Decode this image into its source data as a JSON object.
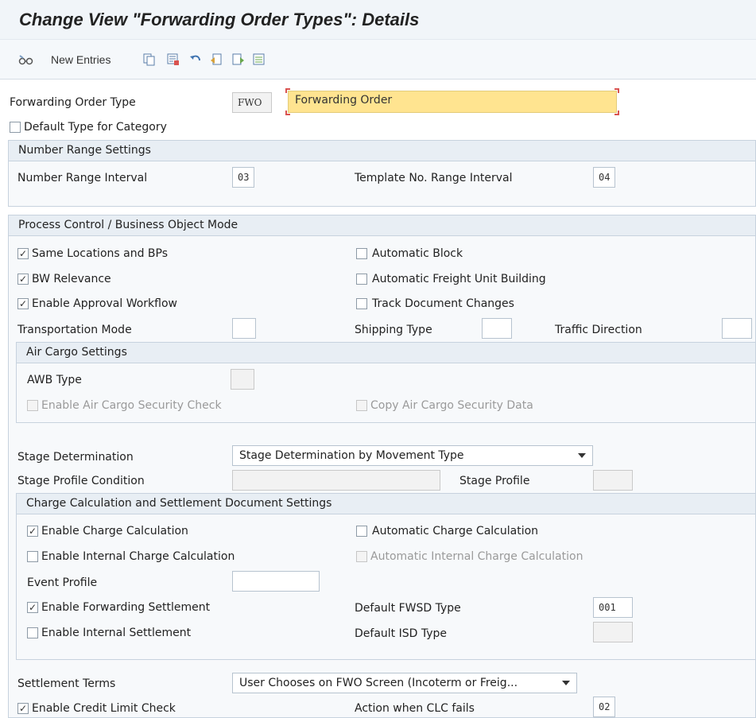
{
  "title": "Change View \"Forwarding Order Types\": Details",
  "toolbar": {
    "new_entries_label": "New Entries",
    "icons": [
      "edit-glasses-icon",
      "copy-icon",
      "delete-icon",
      "undo-icon",
      "previous-entry-icon",
      "next-entry-icon",
      "select-all-icon"
    ]
  },
  "header": {
    "fwd_order_type_label": "Forwarding Order Type",
    "fwd_order_type_code": "FWO",
    "fwd_order_type_desc": "Forwarding Order",
    "default_type_label": "Default Type for Category",
    "default_type_checked": false
  },
  "number_range": {
    "title": "Number Range Settings",
    "interval_label": "Number Range Interval",
    "interval_value": "03",
    "template_label": "Template No. Range Interval",
    "template_value": "04"
  },
  "process_control": {
    "title": "Process Control / Business Object Mode",
    "same_locations_label": "Same Locations and BPs",
    "same_locations_checked": true,
    "bw_relevance_label": "BW Relevance",
    "bw_relevance_checked": true,
    "approval_workflow_label": "Enable Approval Workflow",
    "approval_workflow_checked": true,
    "automatic_block_label": "Automatic Block",
    "automatic_block_checked": false,
    "auto_fu_building_label": "Automatic Freight Unit Building",
    "auto_fu_building_checked": false,
    "track_doc_changes_label": "Track Document Changes",
    "track_doc_changes_checked": false,
    "transport_mode_label": "Transportation Mode",
    "transport_mode_value": "",
    "shipping_type_label": "Shipping Type",
    "shipping_type_value": "",
    "traffic_direction_label": "Traffic Direction",
    "traffic_direction_value": ""
  },
  "air_cargo": {
    "title": "Air Cargo Settings",
    "awb_type_label": "AWB Type",
    "awb_type_value": "",
    "security_check_label": "Enable Air Cargo Security Check",
    "copy_security_label": "Copy Air Cargo Security Data"
  },
  "stage": {
    "determination_label": "Stage Determination",
    "determination_value": "Stage Determination by Movement Type",
    "profile_condition_label": "Stage Profile Condition",
    "profile_condition_value": "",
    "profile_label": "Stage Profile",
    "profile_value": ""
  },
  "charge": {
    "title": "Charge Calculation and Settlement Document Settings",
    "enable_charge_label": "Enable Charge Calculation",
    "enable_charge_checked": true,
    "enable_internal_charge_label": "Enable Internal Charge Calculation",
    "enable_internal_charge_checked": false,
    "auto_charge_label": "Automatic Charge Calculation",
    "auto_charge_checked": false,
    "auto_internal_charge_label": "Automatic Internal Charge Calculation",
    "event_profile_label": "Event Profile",
    "event_profile_value": "",
    "enable_fwd_settlement_label": "Enable Forwarding Settlement",
    "enable_fwd_settlement_checked": true,
    "enable_internal_settlement_label": "Enable Internal Settlement",
    "enable_internal_settlement_checked": false,
    "default_fwsd_label": "Default FWSD Type",
    "default_fwsd_value": "001",
    "default_isd_label": "Default ISD Type",
    "default_isd_value": ""
  },
  "settlement": {
    "terms_label": "Settlement Terms",
    "terms_value": "User Chooses on FWO Screen (Incoterm or Freig...",
    "credit_limit_label": "Enable Credit Limit Check",
    "credit_limit_checked": true,
    "clc_fails_label": "Action when CLC fails",
    "clc_fails_value": "02"
  },
  "colors": {
    "highlight_field": "#ffe490",
    "group_header": "#e8eef4",
    "required_marker": "#d9534f"
  }
}
